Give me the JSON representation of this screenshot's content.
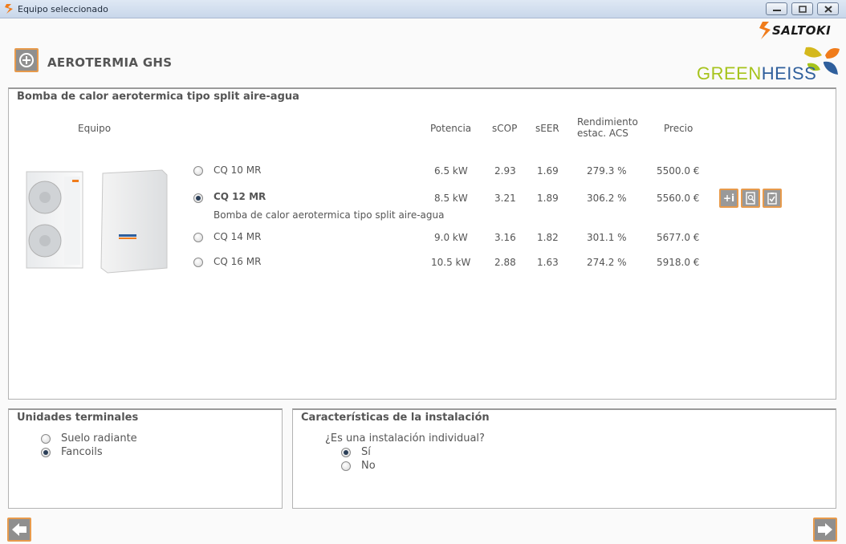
{
  "window": {
    "title": "Equipo seleccionado"
  },
  "brands": {
    "saltoki": "SALTOKI",
    "greenheiss_green": "GREEN",
    "greenheiss_blue": "HEISS"
  },
  "header": {
    "title": "AEROTERMIA GHS"
  },
  "equipment_panel": {
    "title": "Bomba de calor aerotermica tipo split aire-agua",
    "columns": {
      "equipo": "Equipo",
      "potencia": "Potencia",
      "scop": "sCOP",
      "seer": "sEER",
      "rendimiento_1": "Rendimiento",
      "rendimiento_2": "estac. ACS",
      "precio": "Precio"
    },
    "rows": [
      {
        "model": "CQ 10 MR",
        "potencia": "6.5 kW",
        "scop": "2.93",
        "seer": "1.69",
        "rendimiento": "279.3 %",
        "precio": "5500.0 €",
        "selected": false
      },
      {
        "model": "CQ 12 MR",
        "potencia": "8.5 kW",
        "scop": "3.21",
        "seer": "1.89",
        "rendimiento": "306.2 %",
        "precio": "5560.0 €",
        "selected": true,
        "description": "Bomba de calor aerotermica tipo split aire-agua"
      },
      {
        "model": "CQ 14 MR",
        "potencia": "9.0 kW",
        "scop": "3.16",
        "seer": "1.82",
        "rendimiento": "301.1 %",
        "precio": "5677.0 €",
        "selected": false
      },
      {
        "model": "CQ 16 MR",
        "potencia": "10.5 kW",
        "scop": "2.88",
        "seer": "1.63",
        "rendimiento": "274.2 %",
        "precio": "5918.0 €",
        "selected": false
      }
    ],
    "actions": {
      "more_info": "+i"
    }
  },
  "terminal_units": {
    "title": "Unidades terminales",
    "options": [
      {
        "label": "Suelo radiante",
        "selected": false
      },
      {
        "label": "Fancoils",
        "selected": true
      }
    ]
  },
  "installation": {
    "title": "Características de la instalación",
    "question": "¿Es una instalación individual?",
    "options": [
      {
        "label": "Sí",
        "selected": true
      },
      {
        "label": "No",
        "selected": false
      }
    ]
  },
  "icons": {
    "app": "saltoki-s-icon",
    "header": "add-circle-icon",
    "back": "arrow-left-icon",
    "next": "arrow-right-icon",
    "search_doc": "document-search-icon",
    "checklist": "clipboard-check-icon"
  },
  "colors": {
    "accent": "#e79a4c",
    "button_gray": "#8f8f8f",
    "brand_green": "#a6c31c",
    "brand_blue": "#2f5f9c"
  }
}
